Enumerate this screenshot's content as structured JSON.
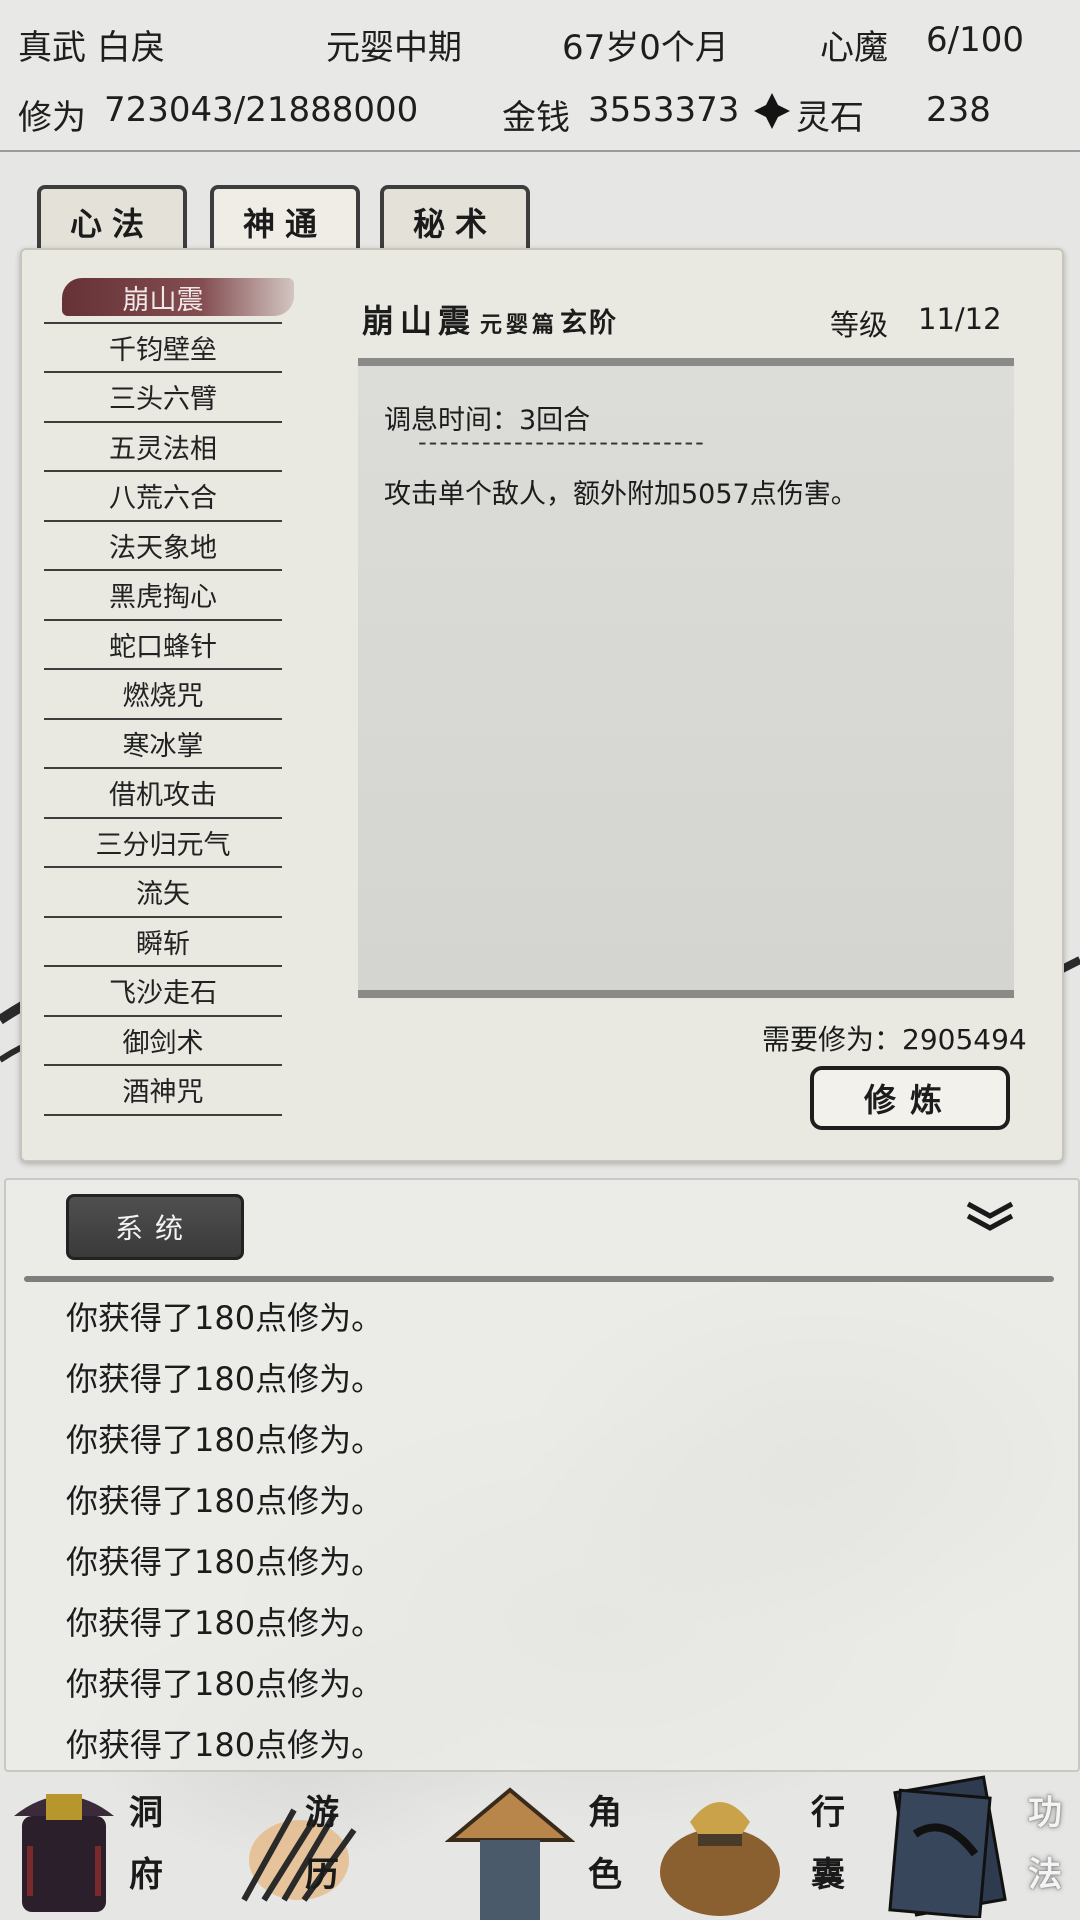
{
  "header": {
    "name": "真武 白戾",
    "realm": "元婴中期",
    "age": "67岁0个月",
    "demon_label": "心魔",
    "demon_value": "6/100",
    "cultivation_label": "修为",
    "cultivation_value": "723043/21888000",
    "money_label": "金钱",
    "money_value": "3553373",
    "stone_label": "灵石",
    "stone_value": "238"
  },
  "tabs": [
    {
      "label": "心法"
    },
    {
      "label": "神通"
    },
    {
      "label": "秘术"
    }
  ],
  "active_tab": "神通",
  "skills": [
    "崩山震",
    "千钧壁垒",
    "三头六臂",
    "五灵法相",
    "八荒六合",
    "法天象地",
    "黑虎掏心",
    "蛇口蜂针",
    "燃烧咒",
    "寒冰掌",
    "借机攻击",
    "三分归元气",
    "流矢",
    "瞬斩",
    "飞沙走石",
    "御剑术",
    "酒神咒"
  ],
  "selected_skill": "崩山震",
  "detail": {
    "name": "崩山震",
    "chapter": "元婴篇",
    "grade": "玄阶",
    "level_label": "等级",
    "level_value": "11/12",
    "cooldown": "调息时间：3回合",
    "divider": "---------------------------",
    "effect": "攻击单个敌人，额外附加5057点伤害。",
    "required_exp": "需要修为：2905494",
    "train_button": "修炼"
  },
  "log": {
    "tab_label": "系统",
    "lines": [
      "你获得了180点修为。",
      "你获得了180点修为。",
      "你获得了180点修为。",
      "你获得了180点修为。",
      "你获得了180点修为。",
      "你获得了180点修为。",
      "你获得了180点修为。",
      "你获得了180点修为。"
    ]
  },
  "nav": [
    {
      "label": "洞府",
      "icon": "cave-mansion-icon"
    },
    {
      "label": "游历",
      "icon": "travel-icon"
    },
    {
      "label": "角色",
      "icon": "character-icon"
    },
    {
      "label": "行囊",
      "icon": "bag-icon"
    },
    {
      "label": "功法",
      "icon": "skill-book-icon",
      "active": true
    }
  ],
  "colors": {
    "selected_skill_bg": "#5f282d",
    "panel_bg": "#e9e8e1",
    "log_tab_bg": "#3a3a3a"
  }
}
